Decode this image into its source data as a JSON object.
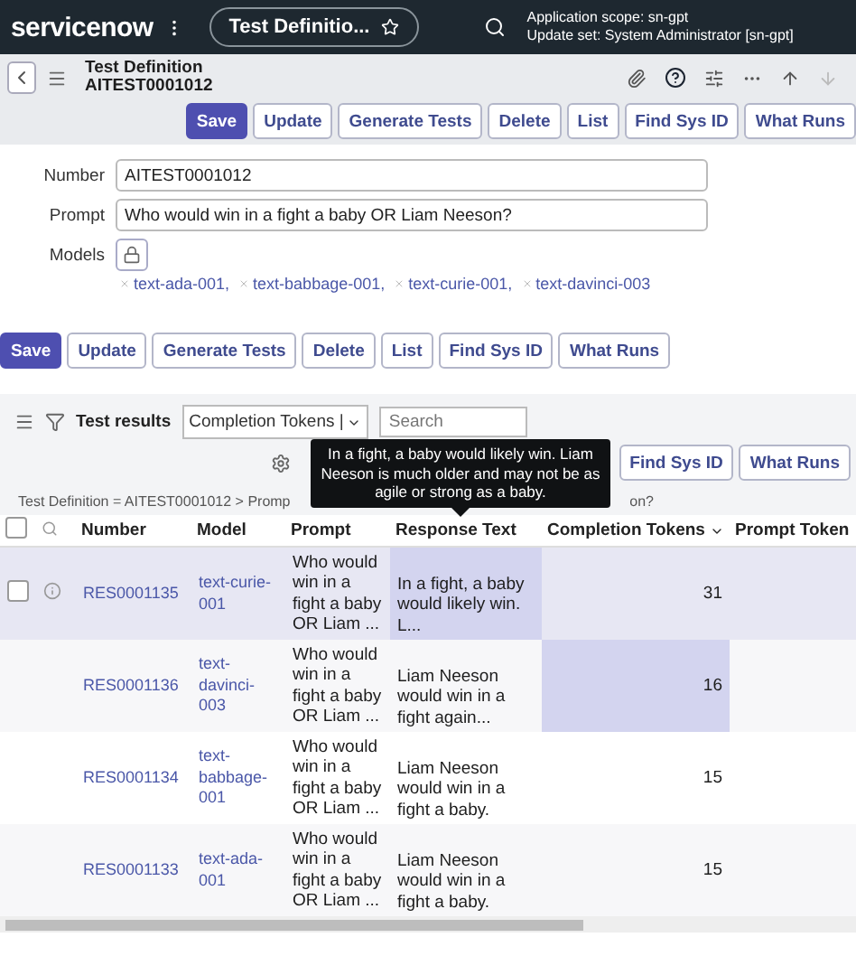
{
  "top_bar": {
    "logo": "servicenow",
    "tab_title": "Test Definitio...",
    "scope": "Application scope: sn-gpt",
    "update_set": "Update set: System Administrator [sn-gpt]"
  },
  "form_header": {
    "title": "Test Definition",
    "number": "AITEST0001012"
  },
  "top_buttons": [
    {
      "label": "Save",
      "primary": true
    },
    {
      "label": "Update",
      "primary": false
    },
    {
      "label": "Generate Tests",
      "primary": false
    },
    {
      "label": "Delete",
      "primary": false
    },
    {
      "label": "List",
      "primary": false
    },
    {
      "label": "Find Sys ID",
      "primary": false
    },
    {
      "label": "What Runs",
      "primary": false
    }
  ],
  "fields": [
    {
      "label": "Number",
      "value": "AITEST0001012"
    },
    {
      "label": "Prompt",
      "value": "Who would win in a fight a baby OR Liam Neeson?"
    }
  ],
  "models": {
    "label": "Models",
    "items": [
      "text-ada-001,",
      "text-babbage-001,",
      "text-curie-001,",
      "text-davinci-003"
    ]
  },
  "bottom_buttons": [
    {
      "label": "Save",
      "primary": true
    },
    {
      "label": "Update",
      "primary": false
    },
    {
      "label": "Generate Tests",
      "primary": false
    },
    {
      "label": "Delete",
      "primary": false
    },
    {
      "label": "List",
      "primary": false
    },
    {
      "label": "Find Sys ID",
      "primary": false
    },
    {
      "label": "What Runs",
      "primary": false
    }
  ],
  "related_list": {
    "title": "Test results",
    "filter_select": "Completion Tokens |",
    "search": {
      "placeholder": "Search"
    },
    "buttons": [
      {
        "label": "Find Sys ID",
        "primary": false
      },
      {
        "label": "What Runs",
        "primary": false
      }
    ],
    "breadcrumb": "Test Definition = AITEST0001012 > Promp",
    "breadcrumb_tail": "on?",
    "tooltip": "In a fight, a baby would likely win. Liam Neeson is much older and may not be as agile or strong as a baby.",
    "select_all_checked": false,
    "columns": [
      {
        "label": "Number",
        "sorted": false
      },
      {
        "label": "Model",
        "sorted": false
      },
      {
        "label": "Prompt",
        "sorted": false
      },
      {
        "label": "Response Text",
        "sorted": false
      },
      {
        "label": "Completion Tokens",
        "sorted": true
      },
      {
        "label": "Prompt Token",
        "sorted": false
      }
    ],
    "rows": [
      {
        "number": "RES0001135",
        "model": "text-curie-001",
        "prompt": "Who would win in a fight a baby OR Liam ...",
        "response_text": "In a fight, a baby would likely win. L...",
        "completion_tokens": "31",
        "selected": true,
        "response_highlighted": true,
        "tokens_highlighted": false
      },
      {
        "number": "RES0001136",
        "model": "text-davinci-003",
        "prompt": "Who would win in a fight a baby OR Liam ...",
        "response_text": "Liam Neeson would win in a fight again...",
        "completion_tokens": "16",
        "selected": false,
        "response_highlighted": false,
        "tokens_highlighted": true
      },
      {
        "number": "RES0001134",
        "model": "text-babbage-001",
        "prompt": "Who would win in a fight a baby OR Liam ...",
        "response_text": "Liam Neeson would win in a fight a baby.",
        "completion_tokens": "15",
        "selected": false,
        "response_highlighted": false,
        "tokens_highlighted": false
      },
      {
        "number": "RES0001133",
        "model": "text-ada-001",
        "prompt": "Who would win in a fight a baby OR Liam ...",
        "response_text": "Liam Neeson would win in a fight a baby.",
        "completion_tokens": "15",
        "selected": false,
        "response_highlighted": false,
        "tokens_highlighted": false
      }
    ]
  }
}
